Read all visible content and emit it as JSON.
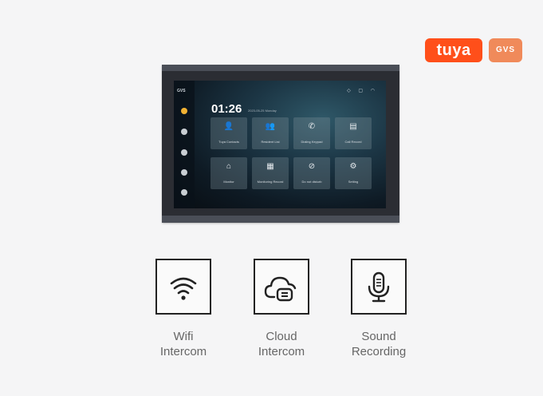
{
  "brands": {
    "tuya": "tuya",
    "gvs": "GVS"
  },
  "device": {
    "sidebar_brand": "GVS",
    "time": "01:26",
    "date": "2023-05-25  Monday",
    "tiles": [
      {
        "icon": "contact-icon",
        "label": "Tuya Contacts"
      },
      {
        "icon": "resident-icon",
        "label": "Resident List"
      },
      {
        "icon": "phone-icon",
        "label": "Dialing Keypad"
      },
      {
        "icon": "record-icon",
        "label": "Call Record"
      },
      {
        "icon": "monitor-icon",
        "label": "Monitor"
      },
      {
        "icon": "monitoring-record-icon",
        "label": "Monitoring Record"
      },
      {
        "icon": "do-not-disturb-icon",
        "label": "Do not disturb"
      },
      {
        "icon": "settings-icon",
        "label": "Setting"
      }
    ]
  },
  "features": [
    {
      "icon": "wifi-icon",
      "line1": "Wifi",
      "line2": "Intercom"
    },
    {
      "icon": "cloud-icon",
      "line1": "Cloud",
      "line2": "Intercom"
    },
    {
      "icon": "microphone-icon",
      "line1": "Sound",
      "line2": "Recording"
    }
  ]
}
